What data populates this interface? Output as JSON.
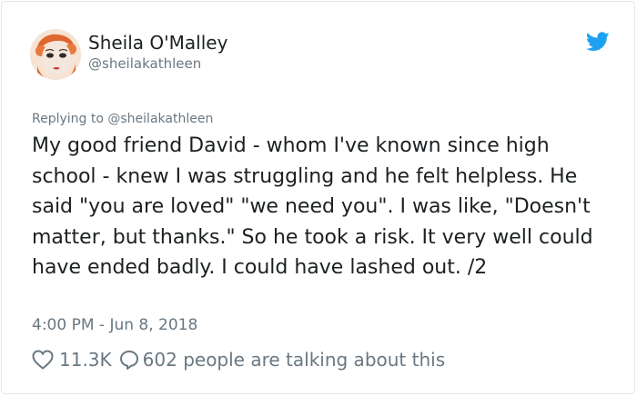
{
  "author": {
    "display_name": "Sheila O'Malley",
    "handle": "@sheilakathleen"
  },
  "reply_context": {
    "prefix": "Replying to",
    "handle": "@sheilakathleen"
  },
  "tweet": {
    "text": "My good friend David - whom I've known since high school - knew I was struggling and he felt helpless. He said \"you are loved\" \"we need you\". I was like, \"Doesn't matter, but thanks.\" So he took a risk. It very well could have ended badly. I could have lashed out. /2",
    "timestamp": "4:00 PM - Jun 8, 2018"
  },
  "actions": {
    "likes": "11.3K",
    "talking": "602 people are talking about this"
  },
  "icons": {
    "like": "heart-icon",
    "reply": "speech-bubble-icon",
    "brand": "twitter-bird-icon"
  },
  "colors": {
    "twitter_blue": "#1da1f2",
    "secondary_text": "#697882",
    "primary_text": "#1c2022",
    "border": "#e1e8ed"
  }
}
